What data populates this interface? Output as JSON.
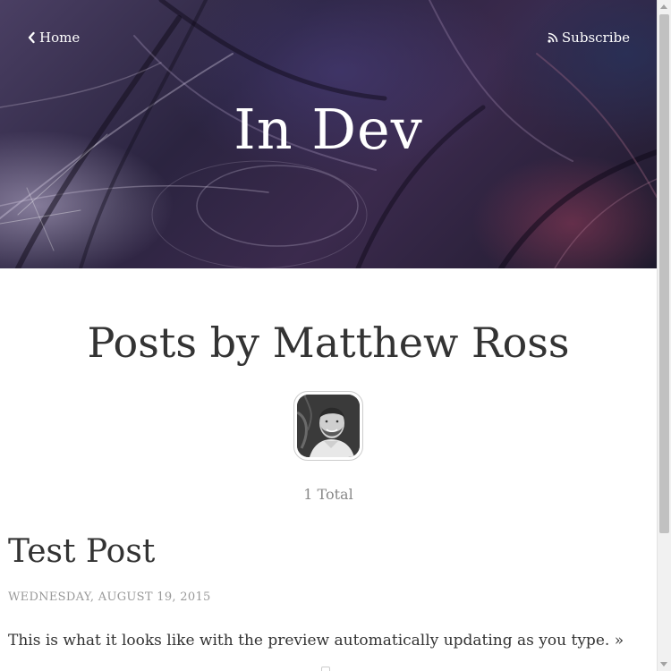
{
  "header": {
    "home_label": "Home",
    "subscribe_label": "Subscribe",
    "blog_title": "In Dev"
  },
  "author": {
    "heading": "Posts by Matthew Ross",
    "post_count": "1 Total"
  },
  "posts": [
    {
      "title": "Test Post",
      "date": "WEDNESDAY, AUGUST 19, 2015",
      "excerpt": "This is what it looks like with the preview automatically updating as you type.",
      "more": "»"
    }
  ],
  "icons": {
    "home": "chevron-left-icon",
    "subscribe": "rss-icon"
  },
  "colors": {
    "text": "#333333",
    "muted": "#999999",
    "header_text": "#ffffff"
  }
}
